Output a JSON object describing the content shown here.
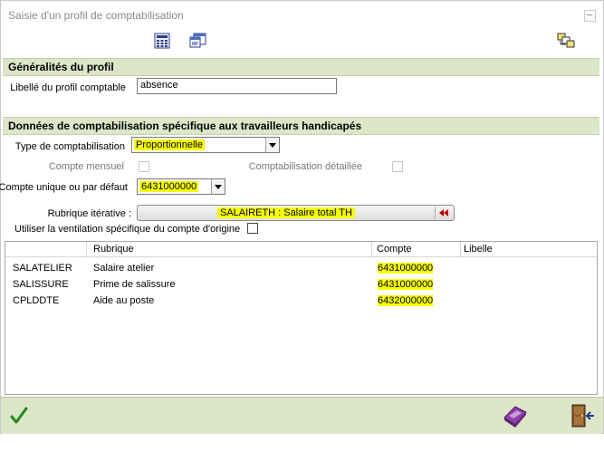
{
  "window": {
    "title": "Saisie d'un profil de comptabilisation"
  },
  "toolbar": {
    "icons": [
      "calculator-icon",
      "window-detail-icon",
      "copy-windows-icon"
    ]
  },
  "sections": {
    "general": "Généralités du profil",
    "specific": "Données de comptabilisation spécifique aux travailleurs handicapés"
  },
  "profile": {
    "label_caption": "Libellé du profil comptable",
    "label_value": "absence"
  },
  "specific": {
    "type_caption": "Type de comptabilisation",
    "type_value": "Proportionnelle",
    "monthly_caption": "Compte mensuel",
    "detailed_caption": "Comptabilisation détaillée",
    "default_account_caption": "Compte unique ou par défaut",
    "default_account_value": "6431000000",
    "iterative_caption": "Rubrique itérative :",
    "iterative_value": "SALAIRETH : Salaire total TH",
    "use_origin_caption": "Utiliser la ventilation spécifique du compte d'origine"
  },
  "grid": {
    "columns": [
      "Rubrique",
      "Compte",
      "Libelle"
    ],
    "rows": [
      {
        "code": "SALATELIER",
        "rubrique": "Salaire atelier",
        "compte": "6431000000",
        "libelle": ""
      },
      {
        "code": "SALISSURE",
        "rubrique": "Prime de salissure",
        "compte": "6431000000",
        "libelle": ""
      },
      {
        "code": "CPLDDTE",
        "rubrique": "Aide au poste",
        "compte": "6432000000",
        "libelle": ""
      }
    ]
  },
  "colors": {
    "section_bg": "#dde6c8",
    "highlight": "#f5ff00",
    "validate": "#1e8c1e",
    "iterative_arrow": "#c00000"
  }
}
